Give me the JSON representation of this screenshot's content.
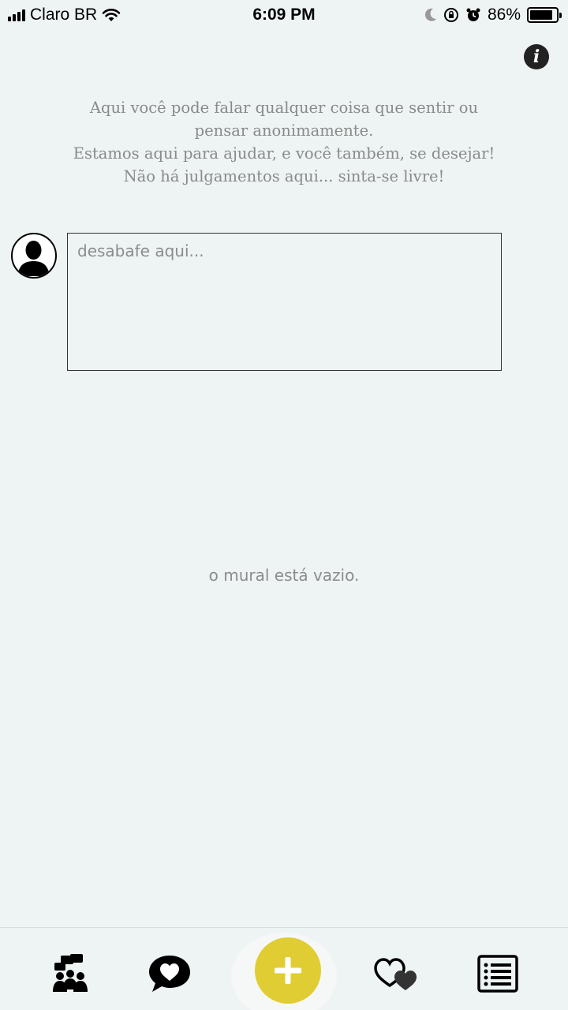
{
  "status_bar": {
    "carrier": "Claro BR",
    "time": "6:09 PM",
    "battery": "86%",
    "battery_level": 0.86,
    "icons": [
      "signal-icon",
      "wifi-icon",
      "moon-icon",
      "rotation-lock-icon",
      "alarm-icon",
      "battery-icon"
    ]
  },
  "header": {
    "info_icon": "info-icon"
  },
  "intro": {
    "line1": "Aqui você pode falar qualquer coisa que sentir ou",
    "line2": "pensar anonimamente.",
    "line3": "Estamos aqui para ajudar, e você também, se desejar!",
    "line4": "Não há julgamentos aqui... sinta-se livre!"
  },
  "composer": {
    "avatar_icon": "user-silhouette-icon",
    "placeholder": "desabafe aqui...",
    "value": ""
  },
  "wall": {
    "empty_message": "o mural está vazio."
  },
  "tab_bar": {
    "accent": "#e0cd34",
    "tabs": [
      "group-chat-icon",
      "heart-speech-icon",
      "add-icon",
      "hearts-icon",
      "list-icon"
    ]
  }
}
